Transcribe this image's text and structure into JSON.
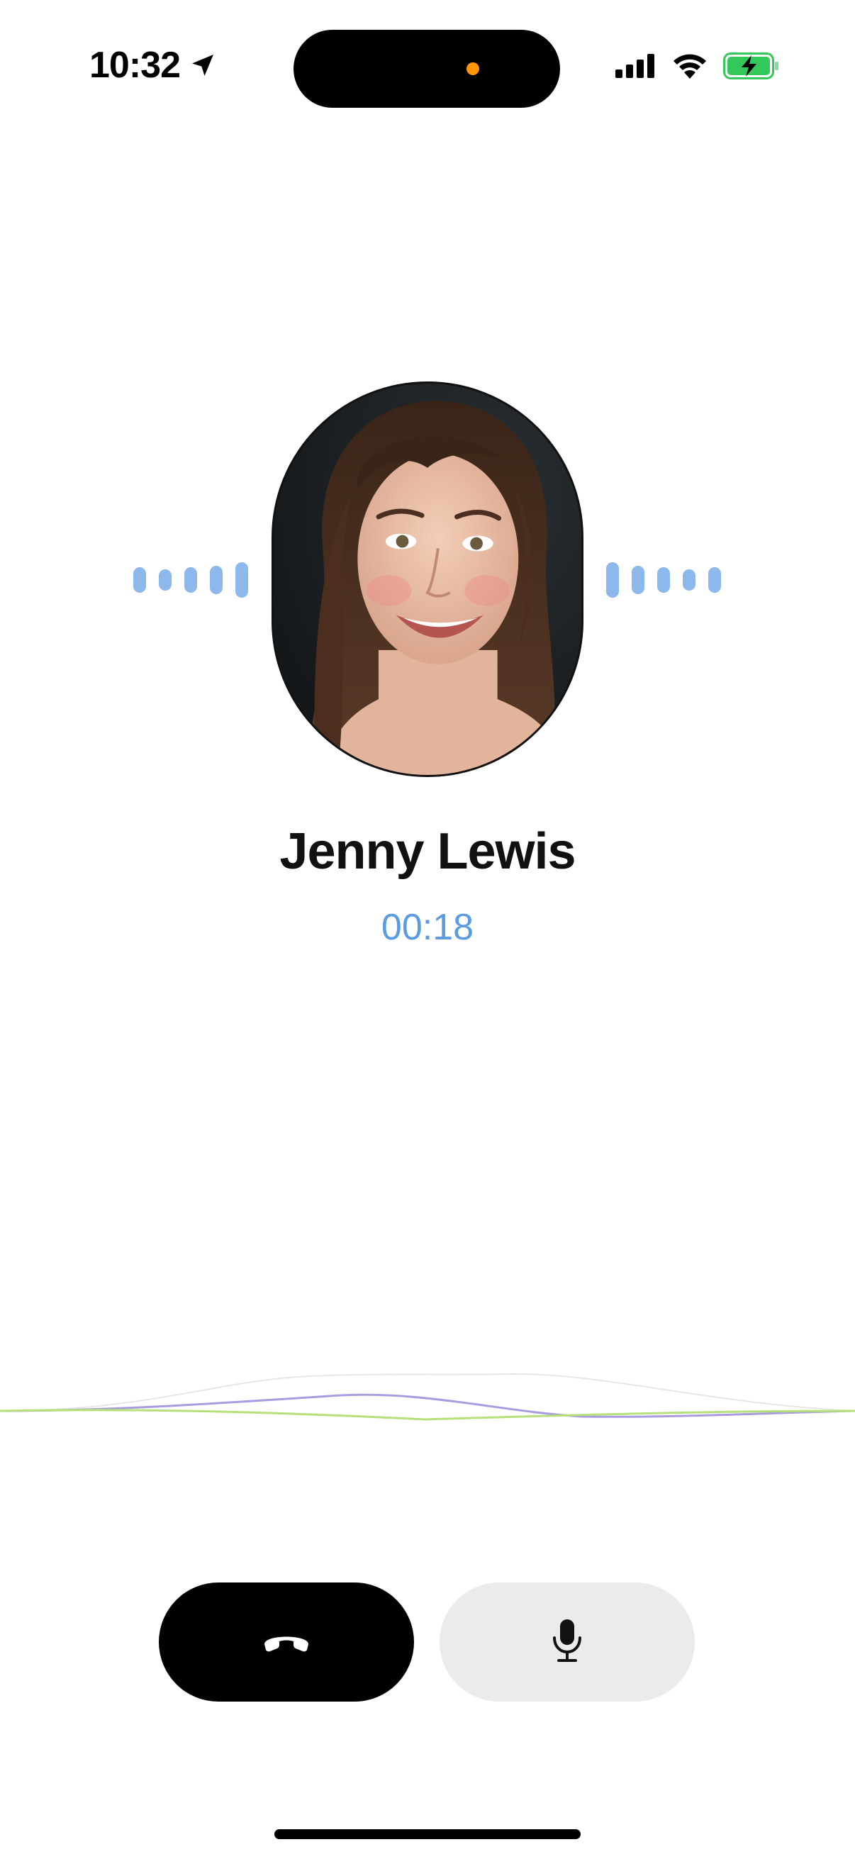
{
  "status_bar": {
    "time": "10:32",
    "location_icon": "location-arrow-icon",
    "signal_icon": "cellular-signal-icon",
    "wifi_icon": "wifi-icon",
    "battery_icon": "battery-charging-icon",
    "battery_color": "#34c759",
    "privacy_indicator_color": "#ff9500"
  },
  "call": {
    "caller_name": "Jenny Lewis",
    "duration": "00:18",
    "accent_color": "#5b9be0"
  },
  "controls": {
    "end_call_icon": "phone-hangup-icon",
    "mute_icon": "microphone-icon"
  }
}
